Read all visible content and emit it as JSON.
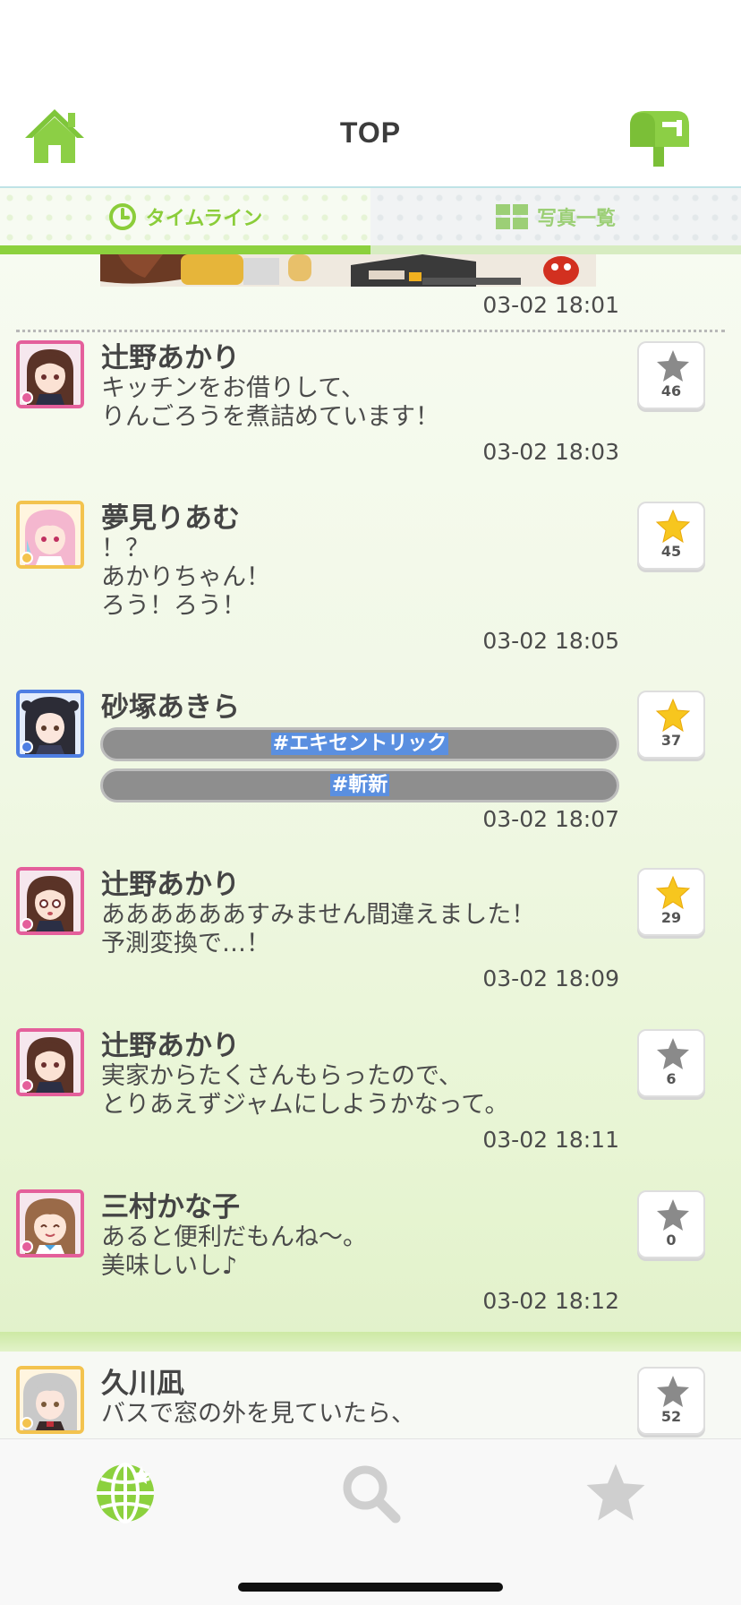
{
  "header": {
    "title": "TOP",
    "home_icon": "home-icon",
    "mail_icon": "mailbox-icon"
  },
  "tabs": [
    {
      "label": "タイムライン",
      "icon": "clock-icon",
      "active": true
    },
    {
      "label": "写真一覧",
      "icon": "grid-icon",
      "active": false
    }
  ],
  "feed": {
    "previous_post_time": "03-02 18:01",
    "posts": [
      {
        "name": "辻野あかり",
        "body": "キッチンをお借りして、\nりんごろうを煮詰めています！",
        "time": "03-02 18:03",
        "fav_count": "46",
        "favorited": false,
        "frame": "pink"
      },
      {
        "name": "夢見りあむ",
        "body": "！？\nあかりちゃん！\nろう！ろう！",
        "time": "03-02 18:05",
        "fav_count": "45",
        "favorited": true,
        "frame": "yellow"
      },
      {
        "name": "砂塚あきら",
        "hashtags": [
          "#エキセントリック",
          "#斬新"
        ],
        "time": "03-02 18:07",
        "fav_count": "37",
        "favorited": true,
        "frame": "blue"
      },
      {
        "name": "辻野あかり",
        "body": "ああああああすみません間違えました！\n予測変換で…！",
        "time": "03-02 18:09",
        "fav_count": "29",
        "favorited": true,
        "frame": "pink"
      },
      {
        "name": "辻野あかり",
        "body": "実家からたくさんもらったので、\nとりあえずジャムにしようかなって。",
        "time": "03-02 18:11",
        "fav_count": "6",
        "favorited": false,
        "frame": "pink"
      },
      {
        "name": "三村かな子",
        "body": "あると便利だもんね～。\n美味しいし♪",
        "time": "03-02 18:12",
        "fav_count": "0",
        "favorited": false,
        "frame": "pink"
      },
      {
        "name": "久川凪",
        "body": "バスで窓の外を見ていたら、",
        "time": "",
        "fav_count": "52",
        "favorited": false,
        "frame": "yellow"
      }
    ]
  },
  "tabbar": {
    "items": [
      {
        "icon": "globe-icon",
        "active": true
      },
      {
        "icon": "search-icon",
        "active": false
      },
      {
        "icon": "star-icon",
        "active": false
      }
    ]
  },
  "colors": {
    "accent_green": "#8cd13e",
    "star_gold": "#f7c61e",
    "star_gray": "#8a8a8a",
    "frame_pink": "#e45f9b",
    "frame_yellow": "#f3c34e",
    "frame_blue": "#4f7fe3"
  }
}
